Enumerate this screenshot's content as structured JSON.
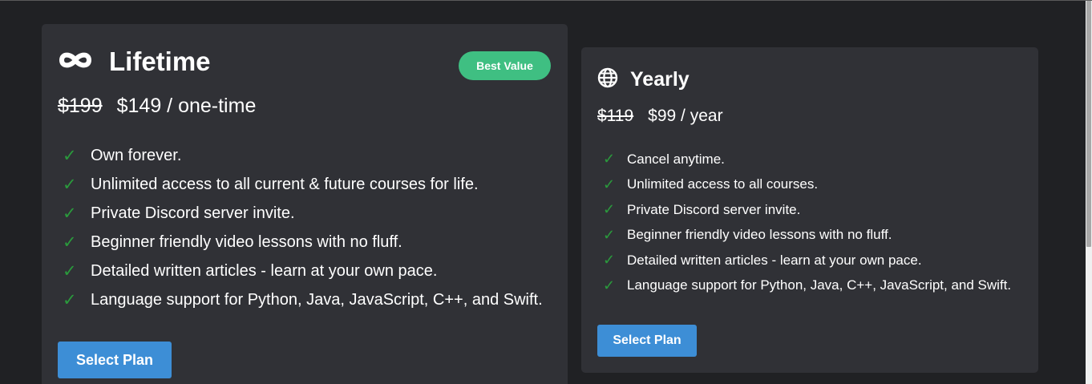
{
  "plans": [
    {
      "icon": "infinity-icon",
      "title": "Lifetime",
      "badge": "Best Value",
      "old_price": "$199",
      "price": "$149 / one-time",
      "features": [
        "Own forever.",
        "Unlimited access to all current & future courses for life.",
        "Private Discord server invite.",
        "Beginner friendly video lessons with no fluff.",
        "Detailed written articles - learn at your own pace.",
        "Language support for Python, Java, JavaScript, C++, and Swift."
      ],
      "button_label": "Select Plan"
    },
    {
      "icon": "globe-icon",
      "title": "Yearly",
      "old_price": "$119",
      "price": "$99 / year",
      "features": [
        "Cancel anytime.",
        "Unlimited access to all courses.",
        "Private Discord server invite.",
        "Beginner friendly video lessons with no fluff.",
        "Detailed written articles - learn at your own pace.",
        "Language support for Python, Java, C++, JavaScript, and Swift."
      ],
      "button_label": "Select Plan"
    }
  ],
  "check_glyph": "✓",
  "colors": {
    "page_background": "#202124",
    "card_background": "#303136",
    "badge": "#3fbf82",
    "button": "#3d8ed6",
    "check": "#2a9a3c"
  }
}
